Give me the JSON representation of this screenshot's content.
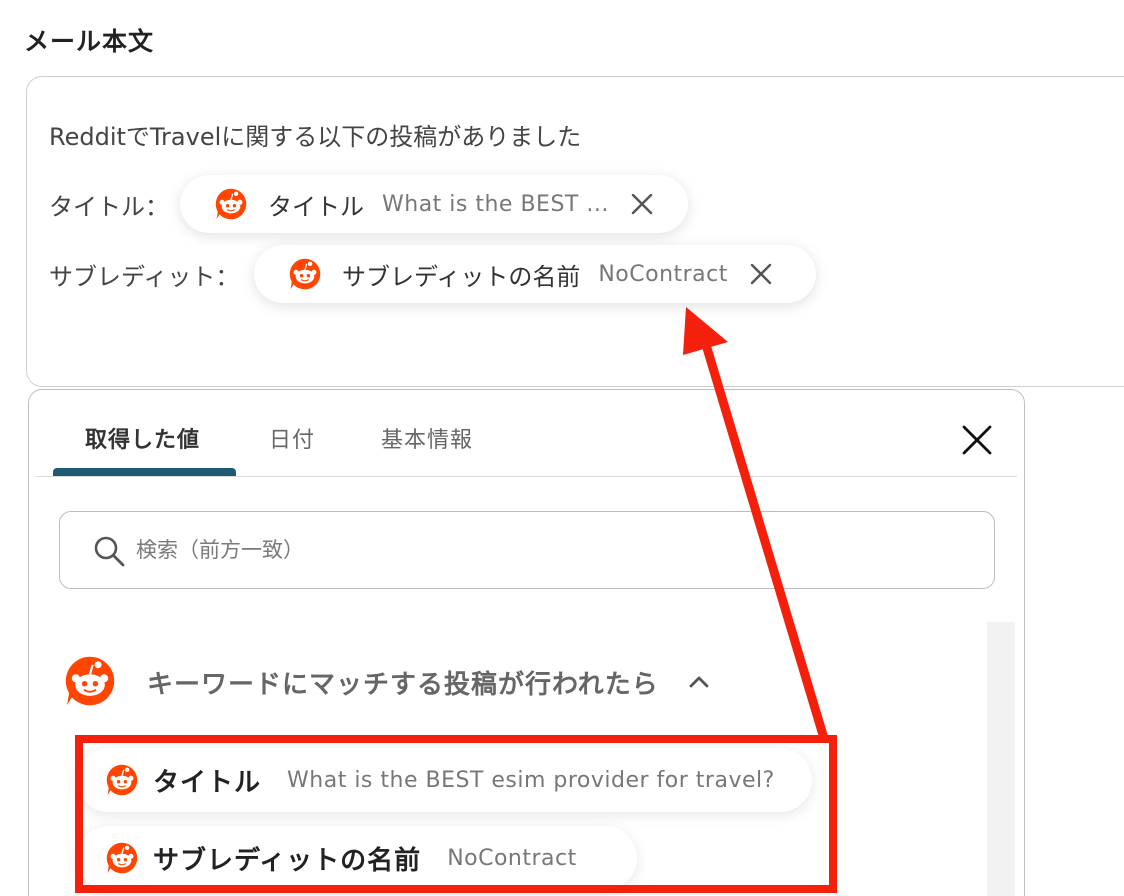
{
  "section_title": "メール本文",
  "editor": {
    "line1": "RedditでTravelに関する以下の投稿がありました",
    "line2_label": "タイトル：",
    "line3_label": "サブレディット：",
    "chip1": {
      "label": "タイトル",
      "value": "What is the BEST ..."
    },
    "chip2": {
      "label": "サブレディットの名前",
      "value": "NoContract"
    }
  },
  "panel": {
    "tabs": [
      {
        "label": "取得した値",
        "active": true
      },
      {
        "label": "日付",
        "active": false
      },
      {
        "label": "基本情報",
        "active": false
      }
    ],
    "search_placeholder": "検索（前方一致）",
    "group_title": "キーワードにマッチする投稿が行われたら",
    "items": [
      {
        "label": "タイトル",
        "value": "What is the BEST esim provider for travel?"
      },
      {
        "label": "サブレディットの名前",
        "value": "NoContract"
      }
    ]
  },
  "colors": {
    "reddit_orange": "#ff4500",
    "tab_indicator": "#1e5b73",
    "annotation_red": "#f5200c"
  },
  "icons": [
    "reddit-icon",
    "close-icon",
    "search-icon",
    "chevron-up-icon",
    "remove-icon"
  ]
}
